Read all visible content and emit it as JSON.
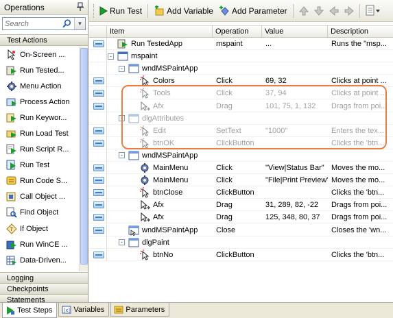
{
  "operations": {
    "title": "Operations",
    "search_placeholder": "Search",
    "category_test_actions": "Test Actions",
    "items": [
      {
        "label": "On-Screen ...",
        "icon": "on-screen-action-icon"
      },
      {
        "label": "Run Tested...",
        "icon": "run-tested-app-icon"
      },
      {
        "label": "Menu Action",
        "icon": "menu-action-icon"
      },
      {
        "label": "Process Action",
        "icon": "process-action-icon"
      },
      {
        "label": "Run Keywor...",
        "icon": "run-keyword-icon"
      },
      {
        "label": "Run Load Test",
        "icon": "run-load-test-icon"
      },
      {
        "label": "Run Script R...",
        "icon": "run-script-icon"
      },
      {
        "label": "Run Test",
        "icon": "run-test-icon"
      },
      {
        "label": "Run Code S...",
        "icon": "run-code-snippet-icon"
      },
      {
        "label": "Call Object ...",
        "icon": "call-object-icon"
      },
      {
        "label": "Find Object",
        "icon": "find-object-icon"
      },
      {
        "label": "If Object",
        "icon": "if-object-icon"
      },
      {
        "label": "Run WinCE ...",
        "icon": "run-wince-icon"
      },
      {
        "label": "Data-Driven...",
        "icon": "data-driven-icon"
      }
    ],
    "category_logging": "Logging",
    "category_checkpoints": "Checkpoints",
    "category_statements": "Statements"
  },
  "toolbar": {
    "run_test": "Run Test",
    "add_variable": "Add Variable",
    "add_parameter": "Add Parameter"
  },
  "grid": {
    "columns": [
      "Item",
      "Operation",
      "Value",
      "Description"
    ],
    "rows": [
      {
        "item": "Run TestedApp",
        "operation": "mspaint",
        "value": "...",
        "description": "Runs the \"msp...",
        "level": 0,
        "icon": "run-tested-app-icon",
        "disabled": false,
        "expander": ""
      },
      {
        "item": "mspaint",
        "operation": "",
        "value": "",
        "description": "",
        "level": 0,
        "icon": "process-icon",
        "disabled": false,
        "expander": "-"
      },
      {
        "item": "wndMSPaintApp",
        "operation": "",
        "value": "",
        "description": "",
        "level": 1,
        "icon": "window-icon",
        "disabled": false,
        "expander": "-"
      },
      {
        "item": "Colors",
        "operation": "Click",
        "value": "69, 32",
        "description": "Clicks at point ...",
        "level": 2,
        "icon": "click-icon",
        "disabled": false,
        "expander": ""
      },
      {
        "item": "Tools",
        "operation": "Click",
        "value": "37, 94",
        "description": "Clicks at point ...",
        "level": 2,
        "icon": "click-icon",
        "disabled": true,
        "expander": ""
      },
      {
        "item": "Afx",
        "operation": "Drag",
        "value": "101, 75, 1, 132",
        "description": "Drags from poi...",
        "level": 2,
        "icon": "drag-icon",
        "disabled": true,
        "expander": ""
      },
      {
        "item": "dlgAttributes",
        "operation": "",
        "value": "",
        "description": "",
        "level": 1,
        "icon": "window-icon",
        "disabled": true,
        "expander": "-"
      },
      {
        "item": "Edit",
        "operation": "SetText",
        "value": "\"1000\"",
        "description": "Enters the tex...",
        "level": 2,
        "icon": "click-icon",
        "disabled": true,
        "expander": ""
      },
      {
        "item": "btnOK",
        "operation": "ClickButton",
        "value": "",
        "description": "Clicks the 'btn...",
        "level": 2,
        "icon": "click-icon",
        "disabled": true,
        "expander": ""
      },
      {
        "item": "wndMSPaintApp",
        "operation": "",
        "value": "",
        "description": "",
        "level": 1,
        "icon": "window-icon",
        "disabled": false,
        "expander": "-"
      },
      {
        "item": "MainMenu",
        "operation": "Click",
        "value": "\"View|Status Bar\"",
        "description": "Moves the mo...",
        "level": 2,
        "icon": "menu-icon",
        "disabled": false,
        "expander": ""
      },
      {
        "item": "MainMenu",
        "operation": "Click",
        "value": "\"File|Print Preview\"",
        "description": "Moves the mo...",
        "level": 2,
        "icon": "menu-icon",
        "disabled": false,
        "expander": ""
      },
      {
        "item": "btnClose",
        "operation": "ClickButton",
        "value": "",
        "description": "Clicks the 'btn...",
        "level": 2,
        "icon": "click-icon",
        "disabled": false,
        "expander": ""
      },
      {
        "item": "Afx",
        "operation": "Drag",
        "value": "31, 289, 82, -22",
        "description": "Drags from poi...",
        "level": 2,
        "icon": "drag-icon",
        "disabled": false,
        "expander": ""
      },
      {
        "item": "Afx",
        "operation": "Drag",
        "value": "125, 348, 80, 37",
        "description": "Drags from poi...",
        "level": 2,
        "icon": "drag-icon",
        "disabled": false,
        "expander": ""
      },
      {
        "item": "wndMSPaintApp",
        "operation": "Close",
        "value": "",
        "description": "Closes the 'wn...",
        "level": 1,
        "icon": "window-close-icon",
        "disabled": false,
        "expander": ""
      },
      {
        "item": "dlgPaint",
        "operation": "",
        "value": "",
        "description": "",
        "level": 1,
        "icon": "window-icon",
        "disabled": false,
        "expander": "-"
      },
      {
        "item": "btnNo",
        "operation": "ClickButton",
        "value": "",
        "description": "Clicks the 'btn...",
        "level": 2,
        "icon": "click-icon",
        "disabled": false,
        "expander": ""
      }
    ]
  },
  "tabs": [
    {
      "label": "Test Steps",
      "active": true
    },
    {
      "label": "Variables",
      "active": false
    },
    {
      "label": "Parameters",
      "active": false
    }
  ],
  "colors": {
    "highlight": "#ee7b3d",
    "selector_block": "#5f97cc"
  }
}
